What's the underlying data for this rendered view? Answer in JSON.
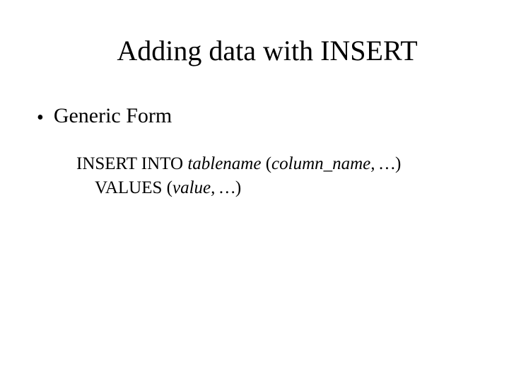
{
  "title": "Adding data with INSERT",
  "bullet": {
    "marker": "•",
    "text": "Generic Form"
  },
  "code": {
    "line1": {
      "part1": "INSERT INTO ",
      "italic1": "tablename",
      "part2": " (",
      "italic2": "column_name, …",
      "part3": ")"
    },
    "line2": {
      "part1": "VALUES (",
      "italic1": "value, …",
      "part2": ")"
    }
  }
}
